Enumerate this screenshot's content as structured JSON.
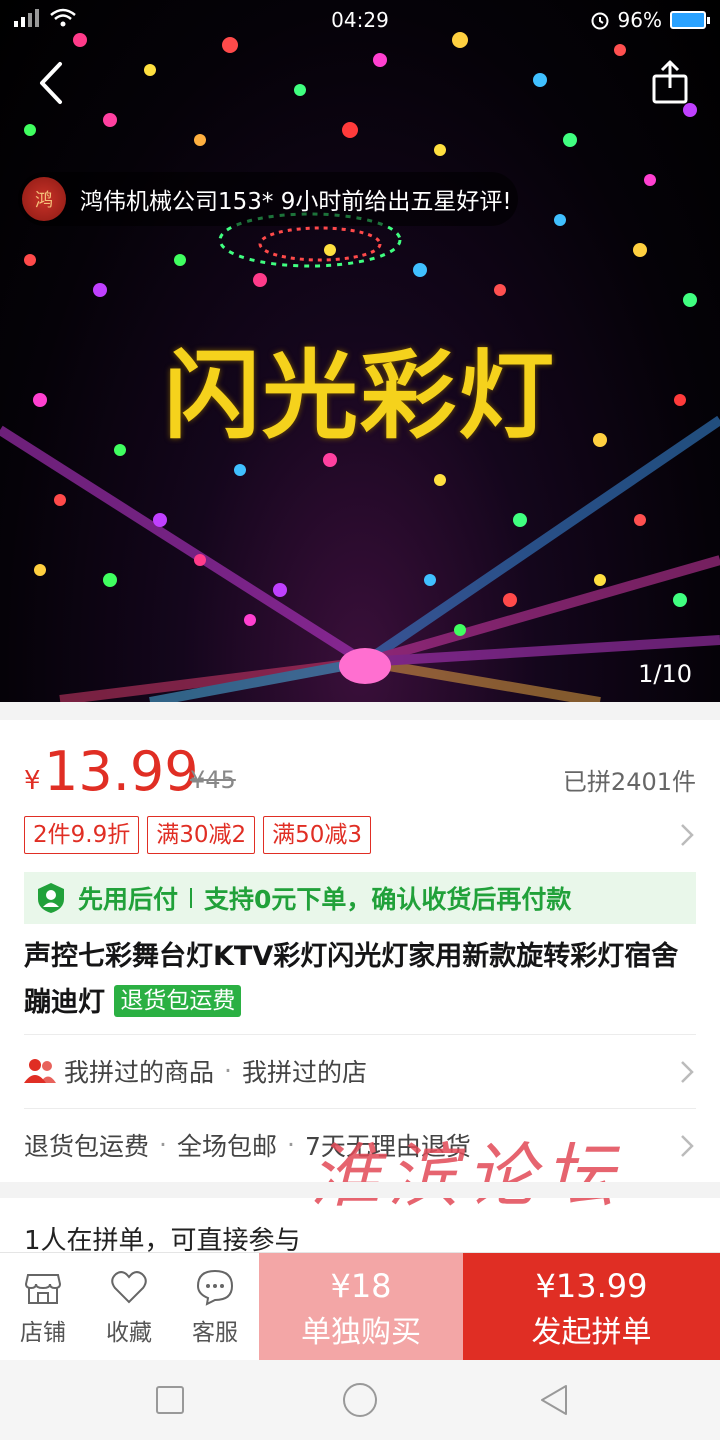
{
  "status_bar": {
    "time": "04:29",
    "battery": "96%"
  },
  "hero": {
    "title_art": "闪光彩灯",
    "review_text": "鸿伟机械公司153* 9小时前给出五星好评!",
    "avatar_text": "鸿",
    "page_indicator": "1/10"
  },
  "price": {
    "currency": "¥",
    "current": "13.99",
    "original": "¥45",
    "sold": "已拼2401件"
  },
  "coupons": [
    "2件9.9折",
    "满30减2",
    "满50减3"
  ],
  "paylater": {
    "title": "先用后付",
    "description": "支持0元下单，确认收货后再付款"
  },
  "product": {
    "title": "声控七彩舞台灯KTV彩灯闪光灯家用新款旋转彩灯宿舍蹦迪灯",
    "tag": "退货包运费"
  },
  "rows": {
    "mine_goods": "我拼过的商品",
    "mine_shops": "我拼过的店",
    "service_1": "退货包运费",
    "service_2": "全场包邮",
    "service_3": "7天无理由退货",
    "separator": "·"
  },
  "watermark": "淮滨论坛",
  "group_info": "1人在拼单，可直接参与",
  "bottom_bar": {
    "shop": "店铺",
    "favorite": "收藏",
    "service": "客服",
    "alone_price": "¥18",
    "alone_label": "单独购买",
    "group_price": "¥13.99",
    "group_label": "发起拼单"
  },
  "colors": {
    "brand_red": "#e02e24",
    "green": "#21a13a",
    "pale_red": "#f3a6a6"
  }
}
